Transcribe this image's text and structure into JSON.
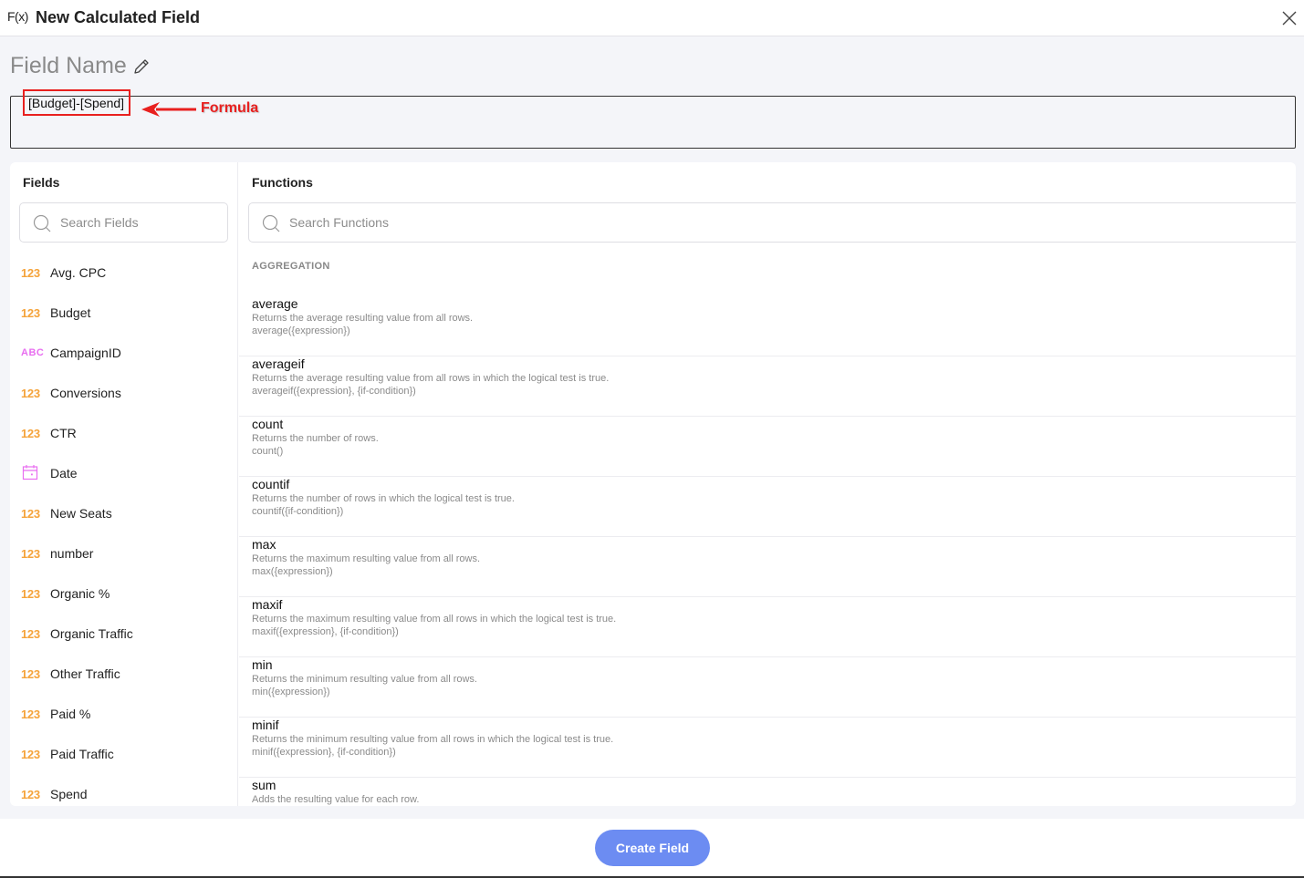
{
  "header": {
    "icon_label": "F(x)",
    "title": "New Calculated Field",
    "close_icon": "close-icon"
  },
  "field_name": {
    "label": "Field Name",
    "edit_icon": "pencil-icon"
  },
  "formula": {
    "value": "[Budget]-[Spend]",
    "annotation": "Formula",
    "annotation_color": "#e8201f"
  },
  "fields_panel": {
    "title": "Fields",
    "search_placeholder": "Search Fields",
    "items": [
      {
        "type": "number",
        "type_label": "123",
        "label": "Avg. CPC"
      },
      {
        "type": "number",
        "type_label": "123",
        "label": "Budget"
      },
      {
        "type": "text",
        "type_label": "ABC",
        "label": "CampaignID"
      },
      {
        "type": "number",
        "type_label": "123",
        "label": "Conversions"
      },
      {
        "type": "number",
        "type_label": "123",
        "label": "CTR"
      },
      {
        "type": "date",
        "type_label": "calendar-icon",
        "label": "Date"
      },
      {
        "type": "number",
        "type_label": "123",
        "label": "New Seats"
      },
      {
        "type": "number",
        "type_label": "123",
        "label": "number"
      },
      {
        "type": "number",
        "type_label": "123",
        "label": "Organic %"
      },
      {
        "type": "number",
        "type_label": "123",
        "label": "Organic Traffic"
      },
      {
        "type": "number",
        "type_label": "123",
        "label": "Other Traffic"
      },
      {
        "type": "number",
        "type_label": "123",
        "label": "Paid %"
      },
      {
        "type": "number",
        "type_label": "123",
        "label": "Paid Traffic"
      },
      {
        "type": "number",
        "type_label": "123",
        "label": "Spend"
      }
    ]
  },
  "functions_panel": {
    "title": "Functions",
    "search_placeholder": "Search Functions",
    "category": "AGGREGATION",
    "items": [
      {
        "name": "average",
        "description": "Returns the average resulting value from all rows.",
        "signature": "average({expression})"
      },
      {
        "name": "averageif",
        "description": "Returns the average resulting value from all rows in which the logical test is true.",
        "signature": "averageif({expression}, {if-condition})"
      },
      {
        "name": "count",
        "description": "Returns the number of rows.",
        "signature": "count()"
      },
      {
        "name": "countif",
        "description": "Returns the number of rows in which the logical test is true.",
        "signature": "countif({if-condition})"
      },
      {
        "name": "max",
        "description": "Returns the maximum resulting value from all rows.",
        "signature": "max({expression})"
      },
      {
        "name": "maxif",
        "description": "Returns the maximum resulting value from all rows in which the logical test is true.",
        "signature": "maxif({expression}, {if-condition})"
      },
      {
        "name": "min",
        "description": "Returns the minimum resulting value from all rows.",
        "signature": "min({expression})"
      },
      {
        "name": "minif",
        "description": "Returns the minimum resulting value from all rows in which the logical test is true.",
        "signature": "minif({expression}, {if-condition})"
      },
      {
        "name": "sum",
        "description": "Adds the resulting value for each row.",
        "signature": ""
      }
    ]
  },
  "footer": {
    "create_label": "Create Field",
    "button_color": "#6c8cf2"
  }
}
